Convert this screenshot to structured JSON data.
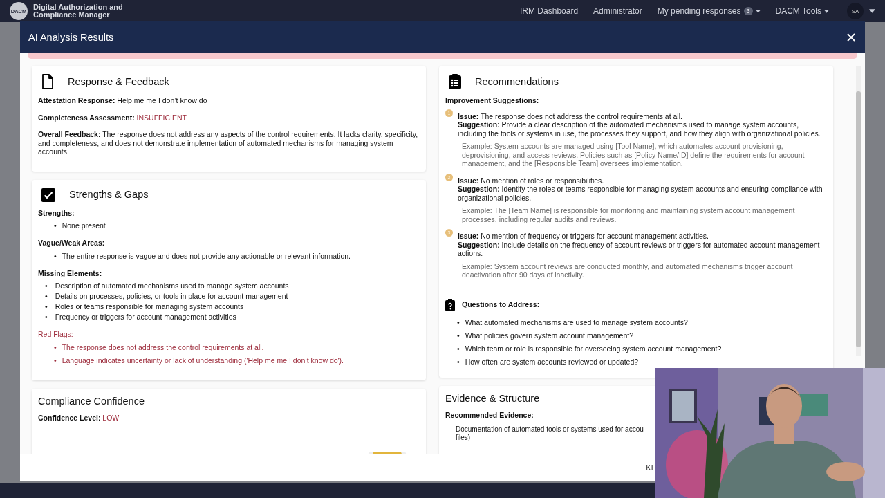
{
  "navbar": {
    "logo": "DACM",
    "app_name": "Digital Authorization and Compliance Manager",
    "links": [
      {
        "label": "IRM Dashboard",
        "dropdown": false
      },
      {
        "label": "Administrator",
        "dropdown": false
      },
      {
        "label": "My pending responses",
        "badge": "3",
        "dropdown": true
      },
      {
        "label": "DACM Tools",
        "dropdown": true
      }
    ],
    "user_initials": "SA"
  },
  "modal": {
    "title": "AI Analysis Results"
  },
  "response_feedback": {
    "title": "Response & Feedback",
    "fields": [
      {
        "label": "Attestation Response:",
        "value": "Help me me I don’t know do",
        "alert": false
      },
      {
        "label": "Completeness Assessment:",
        "value": "INSUFFICIENT",
        "alert": true
      },
      {
        "label": "Overall Feedback:",
        "value": "The response does not address any aspects of the control requirements. It lacks clarity, specificity, and completeness, and does not demonstrate implementation of automated mechanisms for managing system accounts.",
        "alert": false
      }
    ]
  },
  "strengths_gaps": {
    "title": "Strengths & Gaps",
    "sections": [
      {
        "heading": "Strengths:",
        "alert": false,
        "bullet": "•",
        "items": [
          "None present"
        ]
      },
      {
        "heading": "Vague/Weak Areas:",
        "alert": false,
        "bullet": "•",
        "items": [
          "The entire response is vague and does not provide any actionable or relevant information."
        ]
      },
      {
        "heading": "Missing Elements:",
        "alert": false,
        "bullet": "•",
        "items": [
          "Description of automated mechanisms used to manage system accounts",
          "Details on processes, policies, or tools in place for account management",
          "Roles or teams responsible for managing system accounts",
          "Frequency or triggers for account management activities"
        ]
      },
      {
        "heading": "Red Flags:",
        "alert": true,
        "bullet": "•",
        "items": [
          "The response does not address the control requirements at all.",
          "Language indicates uncertainty or lack of understanding ('Help me me I don’t know do')."
        ]
      }
    ]
  },
  "compliance_confidence": {
    "title": "Compliance Confidence",
    "label": "Confidence Level:",
    "value": "LOW",
    "alert": true
  },
  "recommendations": {
    "title": "Recommendations",
    "subtitle": "Improvement Suggestions:",
    "suggestions": [
      {
        "number": "1",
        "issue": "**Issue:** The response does not address the control requirements at all.",
        "suggestion": "**Suggestion:** Provide a clear description of the automated mechanisms used to manage system accounts, including the tools or systems in use, the processes they support, and how they align with organizational policies.",
        "example": "Example: System accounts are managed using [Tool Name], which automates account provisioning, deprovisioning, and access reviews. Policies such as [Policy Name/ID] define the requirements for account management, and the [Responsible Team] oversees implementation."
      },
      {
        "number": "2",
        "issue": "**Issue:** No mention of roles or responsibilities.",
        "suggestion": "**Suggestion:** Identify the roles or teams responsible for managing system accounts and ensuring compliance with organizational policies.",
        "example": "Example: The [Team Name] is responsible for monitoring and maintaining system account management processes, including regular audits and reviews."
      },
      {
        "number": "3",
        "issue": "**Issue:** No mention of frequency or triggers for account management activities.",
        "suggestion": "**Suggestion:** Include details on the frequency of account reviews or triggers for automated account management actions.",
        "example": "Example: System account reviews are conducted monthly, and automated mechanisms trigger account deactivation after 90 days of inactivity."
      }
    ],
    "questions_title": "Questions to Address:",
    "bullet": "•",
    "questions": [
      "What automated mechanisms are used to manage system accounts?",
      "What policies govern system account management?",
      "Which team or role is responsible for overseeing system account management?",
      "How often are system accounts reviewed or updated?"
    ]
  },
  "evidence": {
    "title": "Evidence & Structure",
    "subtitle": "Recommended Evidence:",
    "items": [
      "Documentation of automated tools or systems used for accou\nfiles)"
    ]
  },
  "footer": {
    "button": "KE"
  }
}
